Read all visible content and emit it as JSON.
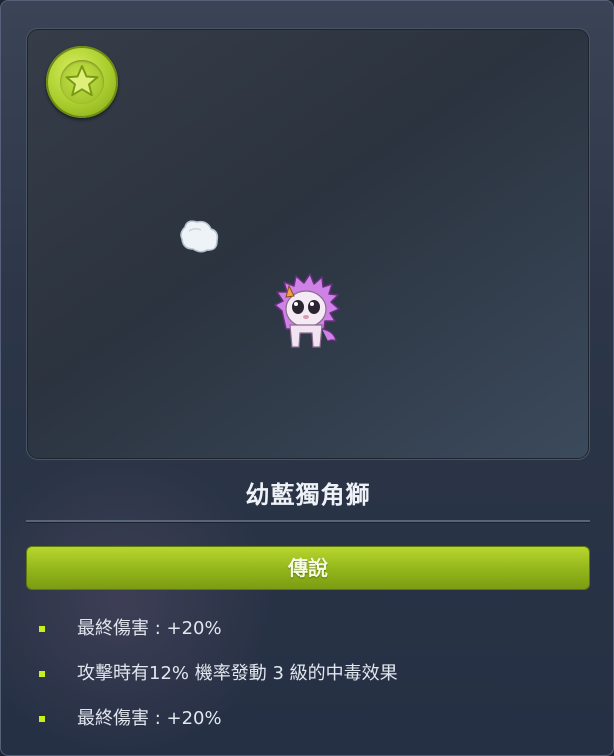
{
  "item": {
    "name": "幼藍獨角獅",
    "badge_icon": "star-grade-icon",
    "rank_label": "傳說",
    "accent_color": "#9cc024"
  },
  "potential_options": [
    {
      "text": "最終傷害 : +20%",
      "bullet_color": "#c8f018"
    },
    {
      "text": "攻擊時有12% 機率發動 3 級的中毒效果",
      "bullet_color": "#c8f018"
    },
    {
      "text": "最終傷害 : +20%",
      "bullet_color": "#c8f018"
    }
  ]
}
